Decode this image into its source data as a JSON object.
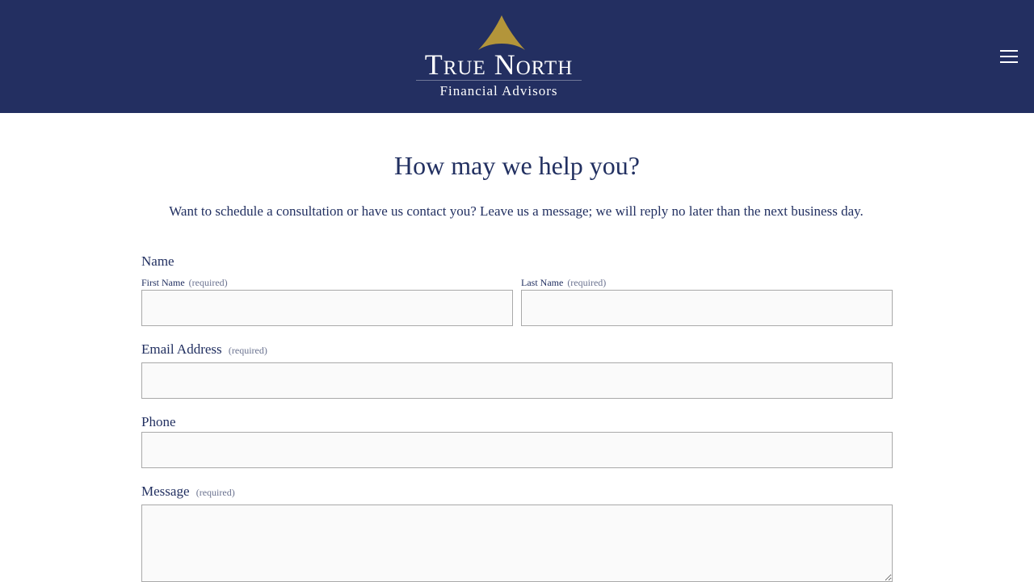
{
  "header": {
    "logo_title": "True North",
    "logo_subtitle": "Financial Advisors",
    "menu_icon": "hamburger-menu-icon",
    "brand_color": "#232f61",
    "accent_color": "#b3953a"
  },
  "main": {
    "title": "How may we help you?",
    "intro": "Want to schedule a consultation or have us contact you? Leave us a message; we will reply no later than the next business day."
  },
  "form": {
    "name_label": "Name",
    "first_name": {
      "label": "First Name",
      "required": "(required)",
      "value": ""
    },
    "last_name": {
      "label": "Last Name",
      "required": "(required)",
      "value": ""
    },
    "email": {
      "label": "Email Address",
      "required": "(required)",
      "value": ""
    },
    "phone": {
      "label": "Phone",
      "value": ""
    },
    "message": {
      "label": "Message",
      "required": "(required)",
      "value": ""
    }
  }
}
